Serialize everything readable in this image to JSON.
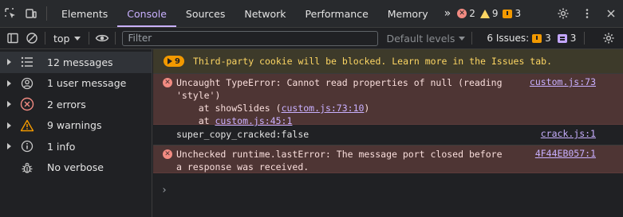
{
  "tabs": [
    {
      "label": "Elements"
    },
    {
      "label": "Console"
    },
    {
      "label": "Sources"
    },
    {
      "label": "Network"
    },
    {
      "label": "Performance"
    },
    {
      "label": "Memory"
    }
  ],
  "counts": {
    "errors": "2",
    "warnings": "9",
    "issues": "3"
  },
  "toolbar": {
    "context": "top",
    "filter_placeholder": "Filter",
    "levels": "Default levels",
    "issues_label": "6 Issues:",
    "issues_orange": "3",
    "issues_blue": "3"
  },
  "sidebar": {
    "items": [
      {
        "label": "12 messages",
        "icon": "list-icon"
      },
      {
        "label": "1 user message",
        "icon": "user-icon"
      },
      {
        "label": "2 errors",
        "icon": "error-icon"
      },
      {
        "label": "9 warnings",
        "icon": "warning-icon"
      },
      {
        "label": "1 info",
        "icon": "info-icon"
      },
      {
        "label": "No verbose",
        "icon": "bug-icon"
      }
    ]
  },
  "messages": {
    "issue": {
      "count": "9",
      "text": "Third-party cookie will be blocked. Learn more in the Issues tab."
    },
    "error1": {
      "line1": "Uncaught TypeError: Cannot read properties of null (reading",
      "line2": "'style')",
      "line3_prefix": "    at showSlides (",
      "line3_link": "custom.js:73:10",
      "line3_suffix": ")",
      "line4_prefix": "    at ",
      "line4_link": "custom.js:45:1",
      "source": "custom.js:73"
    },
    "log": {
      "text": "super_copy_cracked:false",
      "source": "crack.js:1"
    },
    "error2": {
      "line1": "Unchecked runtime.lastError: The message port closed before",
      "line2": "a response was received.",
      "source": "4F44EB057:1"
    },
    "prompt": "›"
  },
  "colors": {
    "accent": "#c9b0ff",
    "error_bg": "#4e3534",
    "warning": "#fdd663",
    "issue_orange": "#f29900"
  }
}
